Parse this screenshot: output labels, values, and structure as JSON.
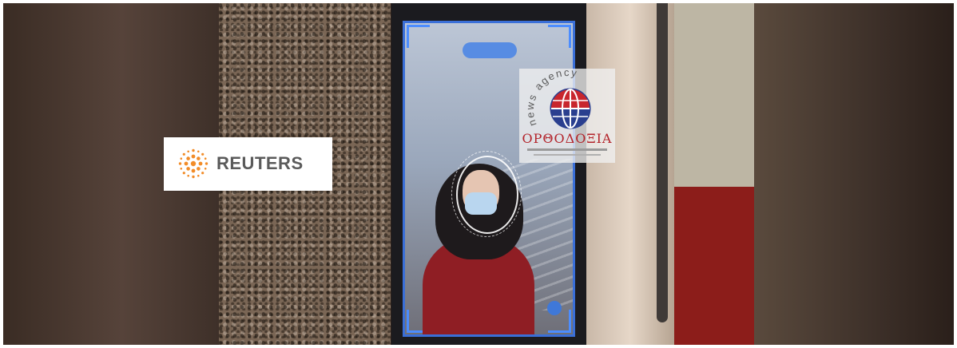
{
  "photo": {
    "subject": "",
    "palette": {
      "accent_blue": "#3a6fd8",
      "coat_red": "#8f1e24",
      "granite": "#7a6655"
    }
  },
  "watermarks": {
    "reuters": {
      "label": "REUTERS",
      "logo_icon": "reuters-dot-sphere-icon",
      "color": "#f28c28"
    },
    "orthodoxia": {
      "tagline": "news agency",
      "name": "ΟΡΘΟΔΟΞΙΑ",
      "logo_icon": "globe-icon",
      "colors": {
        "red": "#c8262d",
        "blue": "#2a3f8f"
      }
    }
  }
}
